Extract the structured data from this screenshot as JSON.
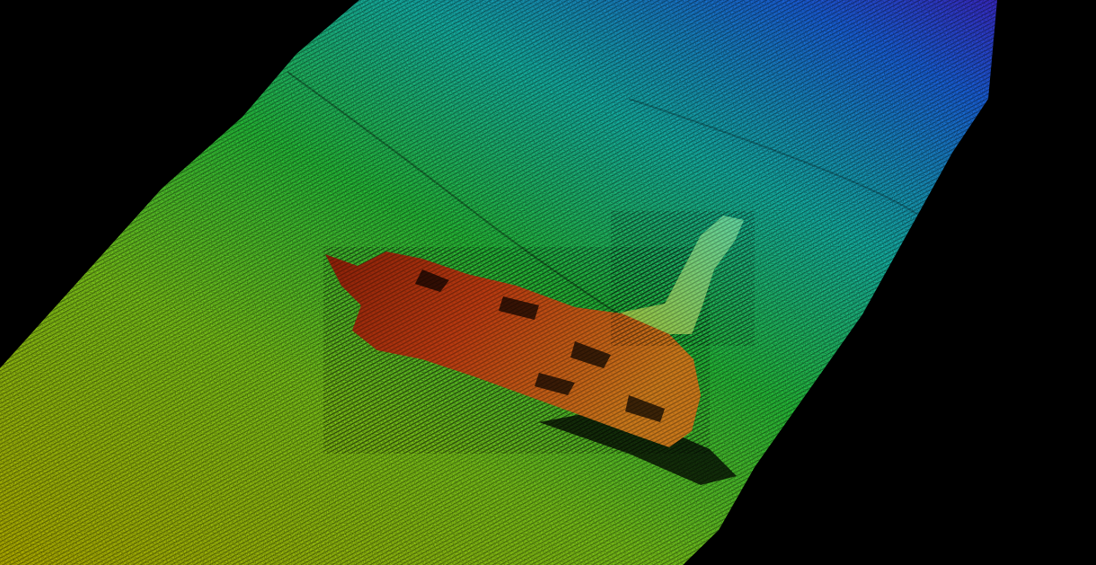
{
  "image": {
    "description_tag": "multibeam-sonar-shipwreck-point-cloud",
    "background_color": "#000000",
    "depth_palette": {
      "shallow": "#b8b400",
      "mid_shallow": "#7cc81a",
      "mid": "#27c23a",
      "mid_deep": "#16b6a8",
      "deep": "#1a64e0",
      "deepest": "#4a12c8"
    },
    "wreck_palette": {
      "hull_dark": "#8a2008",
      "hull": "#b83a10",
      "hull_light": "#c9781a",
      "superstructure": "#9bc23a",
      "mast_tip": "#5fd4a0",
      "shadow": "#000000"
    }
  }
}
